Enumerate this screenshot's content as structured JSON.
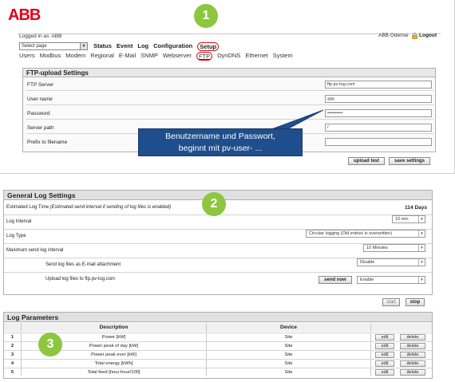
{
  "brand": {
    "logo": "ABB"
  },
  "markers": {
    "m1": "1",
    "m2": "2",
    "m3": "3"
  },
  "header": {
    "logged_in": "Logged in as: ABB",
    "site": "ABB Odense",
    "logout": "Logout"
  },
  "page_select": {
    "value": "Select page"
  },
  "main_nav": [
    "Status",
    "Event",
    "Log",
    "Configuration",
    "Setup"
  ],
  "sub_nav": [
    "Users",
    "Modbus",
    "Modem",
    "Regional",
    "E-Mail",
    "SNMP",
    "Webserver",
    "FTP",
    "DynDNS",
    "Ethernet",
    "System"
  ],
  "ftp": {
    "title": "FTP-upload Settings",
    "fields": [
      {
        "label": "FTP Server",
        "value": "ftp.pv-log.com"
      },
      {
        "label": "User name",
        "value": ""
      },
      {
        "label": "Password",
        "value": "••••••••••"
      },
      {
        "label": "Server path",
        "value": "/"
      },
      {
        "label": "Prefix to filename",
        "value": ""
      }
    ],
    "upload_test": "upload test",
    "save_settings": "save settings"
  },
  "callout": {
    "line1": "Benutzername und Passwort,",
    "line2": "beginnt mit pv-user- ..."
  },
  "log_settings": {
    "title": "General Log Settings",
    "estimated_label": "Estimated Log Time",
    "estimated_note": "(Estimated send interval if sending of log files is enabled)",
    "estimated_value": "114 Days",
    "interval_label": "Log Interval",
    "interval_value": "10 min",
    "type_label": "Log Type",
    "type_value": "Circular logging (Old entries is overwritten)",
    "max_send_label": "Maximum send log interval",
    "max_send_value": "10 Minutes",
    "email_label": "Send log files as E-mail attachment",
    "email_value": "Disable",
    "upload_label": "Upload log files to ftp.pv-log.com",
    "send_now": "send now",
    "upload_value": "Enable",
    "start": "start",
    "stop": "stop"
  },
  "log_params": {
    "title": "Log Parameters",
    "col_description": "Description",
    "col_device": "Device",
    "edit": "edit",
    "delete": "delete",
    "rows": [
      {
        "num": "1",
        "desc": "Power [kW]",
        "device": "Site"
      },
      {
        "num": "2",
        "desc": "Power peak of day [kW]",
        "device": "Site"
      },
      {
        "num": "3",
        "desc": "Power peak ever [kW]",
        "device": "Site"
      },
      {
        "num": "4",
        "desc": "Total energy [kWh]",
        "device": "Site"
      },
      {
        "num": "5",
        "desc": "Total feed [hour:hour/100]",
        "device": "Site"
      }
    ]
  },
  "colors": {
    "brand_red": "#e2001a",
    "marker_green": "#8dc63f",
    "callout_blue": "#1f4e8c",
    "highlight_red": "#e01010"
  }
}
